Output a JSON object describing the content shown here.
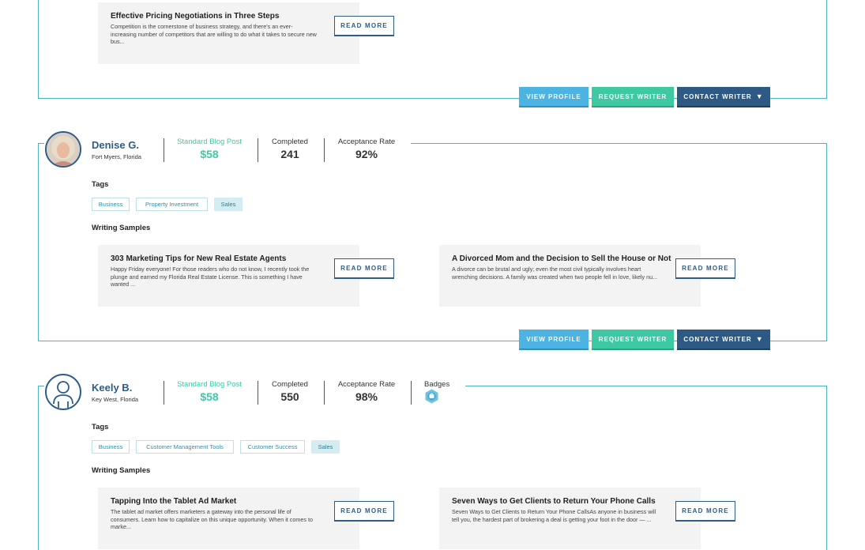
{
  "common": {
    "read_more": "READ MORE",
    "view_profile": "VIEW PROFILE",
    "request_writer": "REQUEST WRITER",
    "contact_writer": "CONTACT WRITER",
    "tags_heading": "Tags",
    "samples_heading": "Writing Samples",
    "price_label": "Standard Blog Post",
    "completed_label": "Completed",
    "acceptance_label": "Acceptance Rate",
    "badges_label": "Badges"
  },
  "top_sample": {
    "title": "Effective Pricing Negotiations in Three Steps",
    "body": "Competition is the cornerstone of business strategy, and there's an ever-increasing number of competitors that are willing to do what it takes to secure new bus..."
  },
  "writers": [
    {
      "name": "Denise G.",
      "location": "Fort Myers, Florida",
      "price": "$58",
      "completed": "241",
      "acceptance": "92%",
      "tags": [
        "Business",
        "Property Investment",
        "Sales"
      ],
      "samples": [
        {
          "title": "303 Marketing Tips for New Real Estate Agents",
          "body": "Happy Friday everyone! For those readers who do not know, I recently took the plunge and earned my Florida Real Estate License. This is something I have wanted ..."
        },
        {
          "title": "A Divorced Mom and the Decision to Sell the House or Not",
          "body": "A divorce can be brutal and ugly; even the most civil typically involves heart wrenching decisions. A family was created when two people fell in love, likely nu..."
        }
      ]
    },
    {
      "name": "Keely B.",
      "location": "Key West, Florida",
      "price": "$58",
      "completed": "550",
      "acceptance": "98%",
      "tags": [
        "Business",
        "Customer Management Tools",
        "Customer Success",
        "Sales"
      ],
      "samples": [
        {
          "title": "Tapping Into the Tablet Ad Market",
          "body": "The tablet ad market offers marketers a gateway into the personal life of consumers. Learn how to capitalize on this unique opportunity. When it comes to marke..."
        },
        {
          "title": "Seven Ways to Get Clients to Return Your Phone Calls",
          "body": "Seven Ways to Get Clients to Return Your Phone CallsAs anyone in business will tell you, the hardest part of brokering a deal is getting your foot in the door — ..."
        }
      ]
    }
  ],
  "colors": {
    "accent_line": "#49b4bf",
    "name_blue": "#2d5d88",
    "price_green": "#3fc9a3",
    "view_btn": "#4cb3e2",
    "request_btn": "#3fc9a3",
    "contact_btn": "#2f5985"
  },
  "icons": {
    "caret": "caret-down-icon",
    "badge": "shopping-badge-icon",
    "default_avatar": "user-placeholder-icon"
  }
}
